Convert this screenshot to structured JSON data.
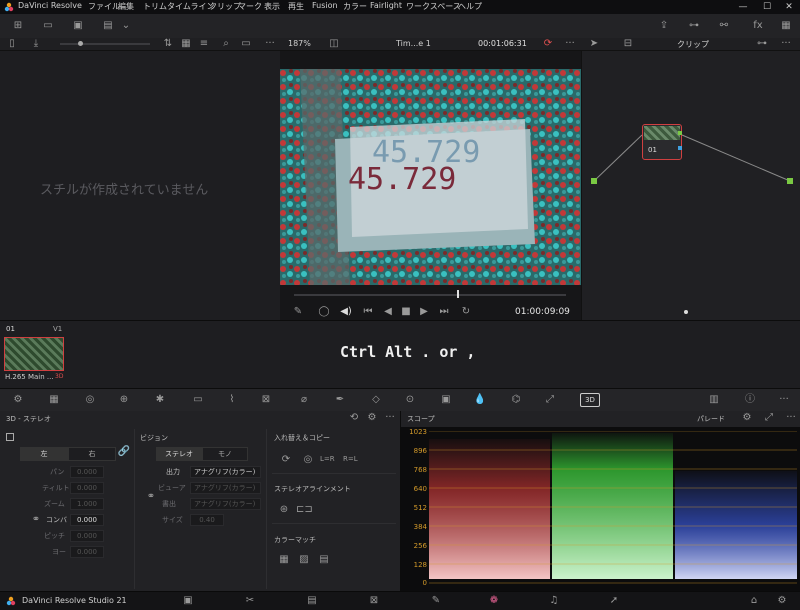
{
  "app": {
    "title": "DaVinci Resolve",
    "menu": [
      "ファイル",
      "編集",
      "トリム",
      "タイムライン",
      "クリップ",
      "マーク",
      "表示",
      "再生",
      "Fusion",
      "カラー",
      "Fairlight",
      "ワークスペース",
      "ヘルプ"
    ]
  },
  "toolbar": {
    "zoom": "187%",
    "timeline_name": "Tim...e 1",
    "timecode": "00:01:06:31",
    "clip_mode": "クリップ"
  },
  "gallery": {
    "empty_message": "スチルが作成されていません"
  },
  "viewer": {
    "image_text": "45.729",
    "timecode": "01:00:09:09",
    "playhead_fraction": 0.6
  },
  "nodes": {
    "node_label": "01"
  },
  "timeline": {
    "clip_number": "01",
    "track": "V1",
    "clip_name": "H.265 Main ...",
    "clip_badge": "3D",
    "overlay_text": "Ctrl Alt . or ,"
  },
  "stereo": {
    "panel_title": "3D - ステレオ",
    "eye_tabs": [
      "左",
      "右"
    ],
    "fields": [
      {
        "label": "パン",
        "value": "0.000"
      },
      {
        "label": "ティルト",
        "value": "0.000"
      },
      {
        "label": "ズーム",
        "value": "1.000"
      },
      {
        "label": "コンバ",
        "value": "0.000"
      },
      {
        "label": "ピッチ",
        "value": "0.000"
      },
      {
        "label": "ヨー",
        "value": "0.000"
      }
    ],
    "vision": {
      "title": "ビジョン",
      "tabs": [
        "ステレオ",
        "モノ"
      ],
      "output_label": "出力",
      "output_value": "アナグリフ(カラー)",
      "viewer_label": "ビューア",
      "viewer_value": "アナグリフ(カラー)",
      "render_label": "書出",
      "render_value": "アナグリフ(カラー)",
      "size_label": "サイズ",
      "size_value": "0.40"
    },
    "swap": {
      "title": "入れ替え＆コピー",
      "lr": "L=R",
      "rl": "R=L"
    },
    "align": {
      "title": "ステレオアラインメント"
    },
    "color_match": {
      "title": "カラーマッチ"
    }
  },
  "scopes": {
    "title": "スコープ",
    "mode": "パレード",
    "y_ticks": [
      "1023",
      "896",
      "768",
      "640",
      "512",
      "384",
      "256",
      "128",
      "0"
    ],
    "colors": {
      "red": "#e23b3b",
      "green": "#3bd23b",
      "blue": "#3b5be2",
      "grid": "#d39a2a"
    }
  },
  "bottom": {
    "product": "DaVinci Resolve Studio 21"
  }
}
